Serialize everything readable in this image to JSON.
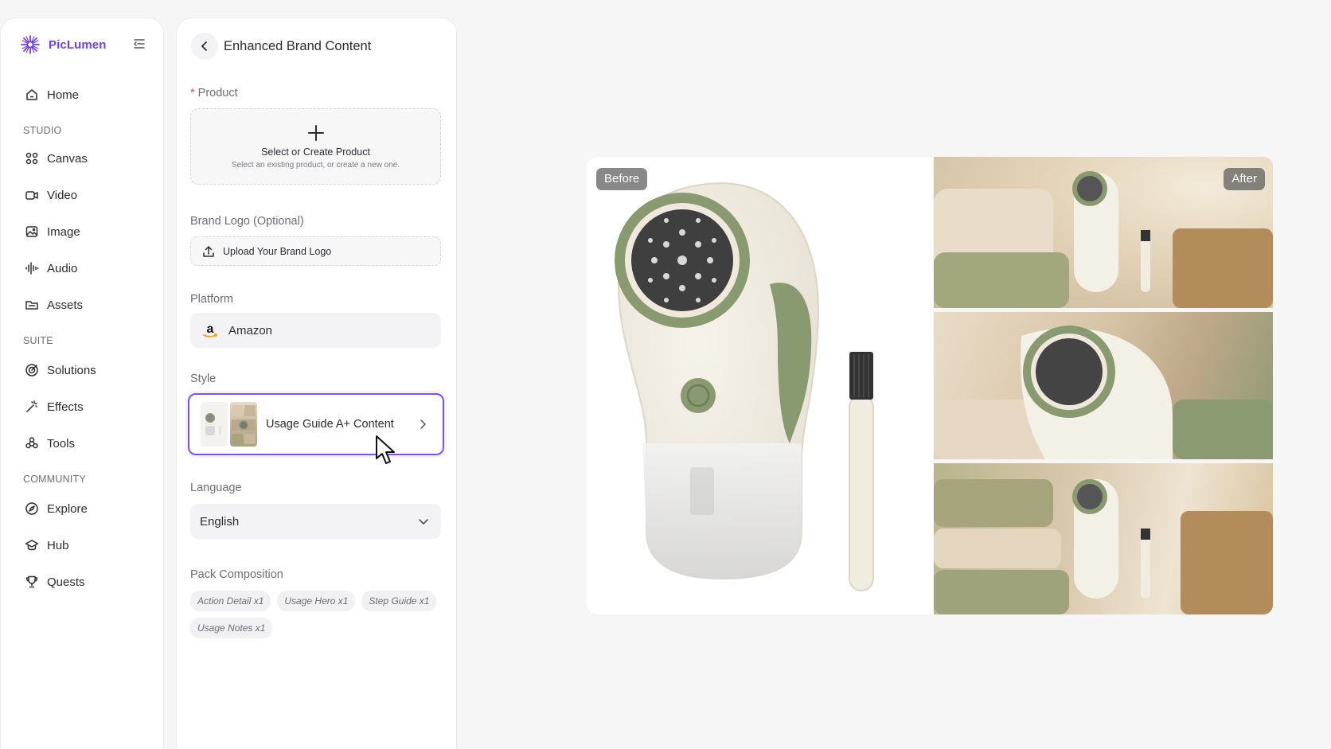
{
  "app": {
    "name": "PicLumen"
  },
  "sidebar": {
    "items": [
      {
        "label": "Home",
        "icon": "home-icon"
      },
      {
        "section": "STUDIO"
      },
      {
        "label": "Canvas",
        "icon": "canvas-icon"
      },
      {
        "label": "Video",
        "icon": "video-icon"
      },
      {
        "label": "Image",
        "icon": "image-icon"
      },
      {
        "label": "Audio",
        "icon": "audio-icon"
      },
      {
        "label": "Assets",
        "icon": "folder-icon"
      },
      {
        "section": "SUITE"
      },
      {
        "label": "Solutions",
        "icon": "target-icon"
      },
      {
        "label": "Effects",
        "icon": "magic-wand-icon"
      },
      {
        "label": "Tools",
        "icon": "tools-icon"
      },
      {
        "section": "COMMUNITY"
      },
      {
        "label": "Explore",
        "icon": "compass-icon"
      },
      {
        "label": "Hub",
        "icon": "graduation-cap-icon"
      },
      {
        "label": "Quests",
        "icon": "trophy-icon"
      }
    ]
  },
  "panel": {
    "title": "Enhanced Brand Content",
    "product": {
      "label": "Product",
      "required_mark": "*",
      "title": "Select or Create Product",
      "subtitle": "Select an existing product, or create a new one."
    },
    "brand_logo": {
      "label": "Brand Logo (Optional)",
      "button": "Upload Your Brand Logo"
    },
    "platform": {
      "label": "Platform",
      "value": "Amazon"
    },
    "style": {
      "label": "Style",
      "value": "Usage Guide A+ Content"
    },
    "language": {
      "label": "Language",
      "value": "English"
    },
    "pack": {
      "label": "Pack Composition",
      "chips": [
        "Action Detail x1",
        "Usage Hero x1",
        "Step Guide x1",
        "Usage Notes x1"
      ]
    }
  },
  "preview": {
    "before_label": "Before",
    "after_label": "After"
  },
  "colors": {
    "accent": "#6d3ff0",
    "style_border": "#7b52ee",
    "required": "#e5484d"
  }
}
